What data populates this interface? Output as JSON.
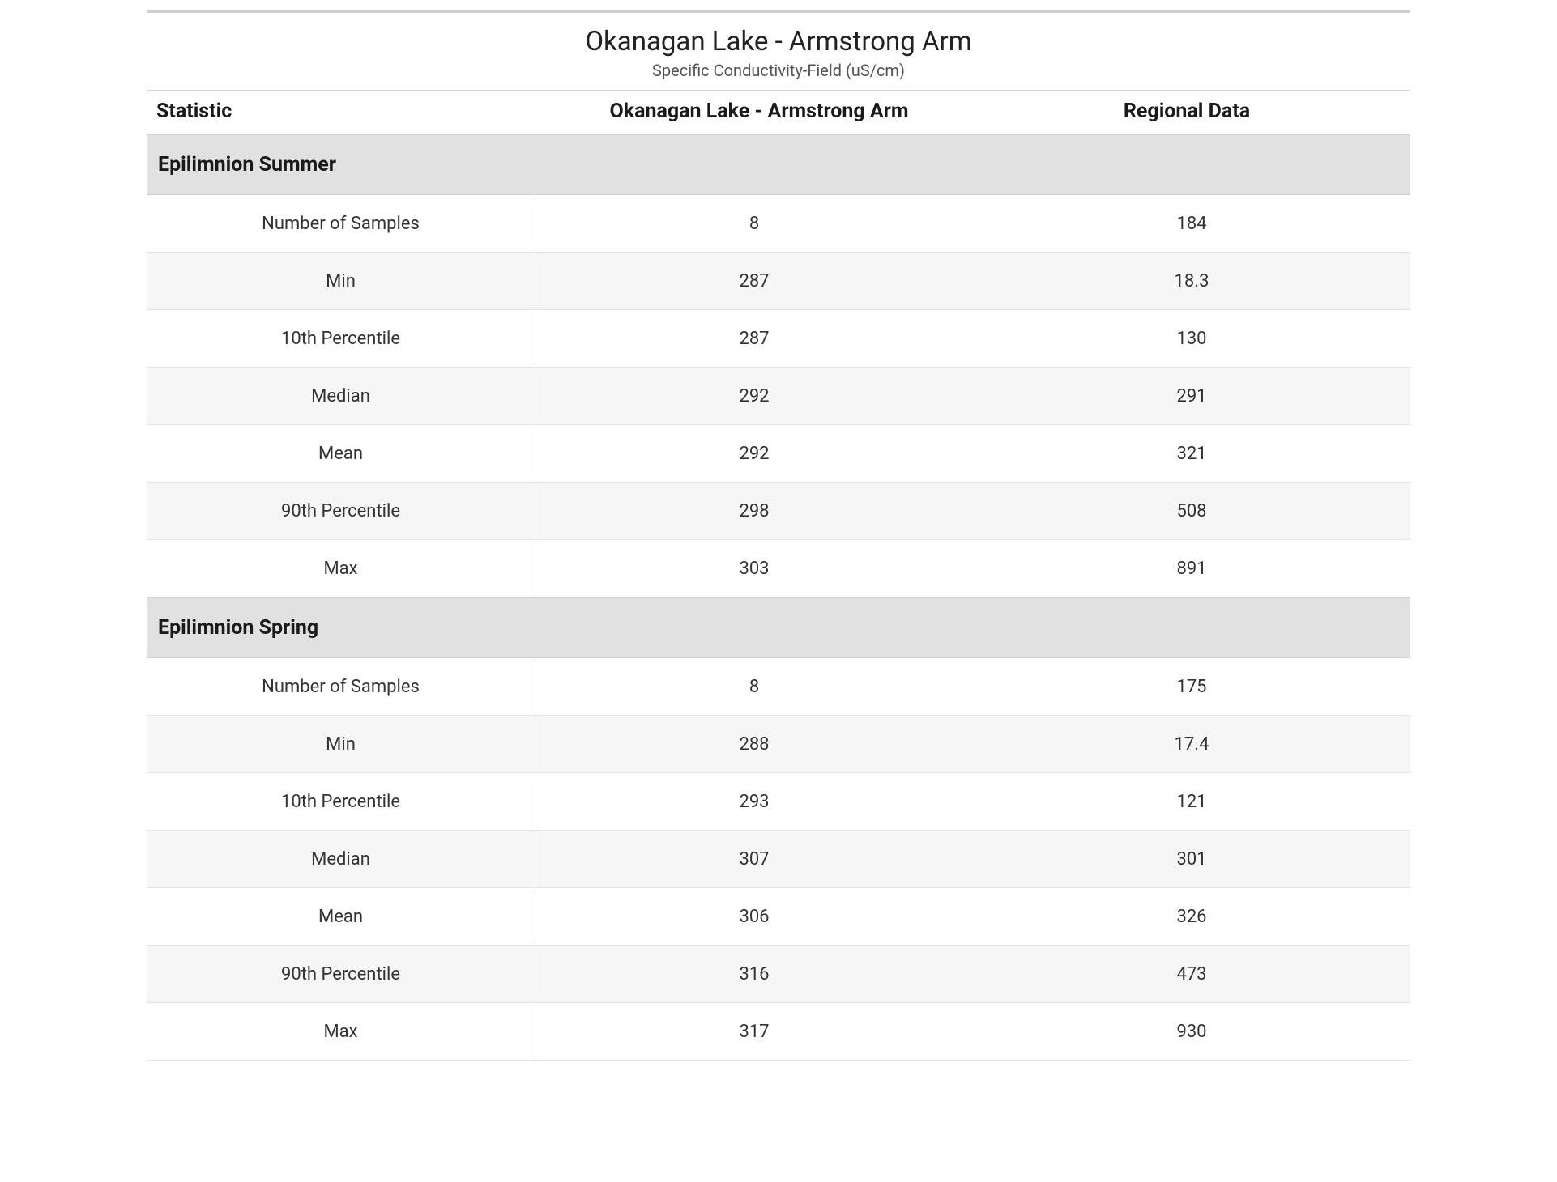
{
  "title": "Okanagan Lake - Armstrong Arm",
  "subtitle": "Specific Conductivity-Field (uS/cm)",
  "columns": {
    "statistic": "Statistic",
    "site": "Okanagan Lake - Armstrong Arm",
    "region": "Regional Data"
  },
  "groups": [
    {
      "name": "Epilimnion Summer",
      "rows": [
        {
          "statistic": "Number of Samples",
          "site": "8",
          "region": "184"
        },
        {
          "statistic": "Min",
          "site": "287",
          "region": "18.3"
        },
        {
          "statistic": "10th Percentile",
          "site": "287",
          "region": "130"
        },
        {
          "statistic": "Median",
          "site": "292",
          "region": "291"
        },
        {
          "statistic": "Mean",
          "site": "292",
          "region": "321"
        },
        {
          "statistic": "90th Percentile",
          "site": "298",
          "region": "508"
        },
        {
          "statistic": "Max",
          "site": "303",
          "region": "891"
        }
      ]
    },
    {
      "name": "Epilimnion Spring",
      "rows": [
        {
          "statistic": "Number of Samples",
          "site": "8",
          "region": "175"
        },
        {
          "statistic": "Min",
          "site": "288",
          "region": "17.4"
        },
        {
          "statistic": "10th Percentile",
          "site": "293",
          "region": "121"
        },
        {
          "statistic": "Median",
          "site": "307",
          "region": "301"
        },
        {
          "statistic": "Mean",
          "site": "306",
          "region": "326"
        },
        {
          "statistic": "90th Percentile",
          "site": "316",
          "region": "473"
        },
        {
          "statistic": "Max",
          "site": "317",
          "region": "930"
        }
      ]
    }
  ]
}
